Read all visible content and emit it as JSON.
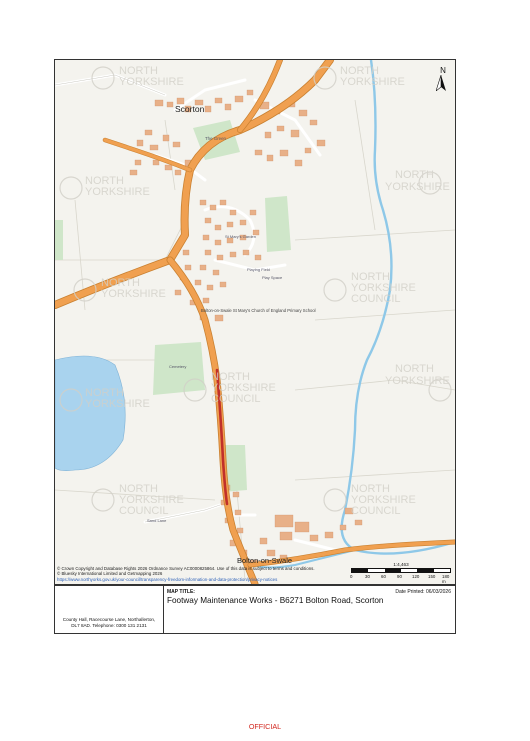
{
  "map": {
    "place_labels": {
      "scorton": "Scorton",
      "bolton": "Bolton-on-Swale",
      "green": "The Green",
      "school": "Bolton-on-Swale St Mary's Church of England Primary School",
      "cemetery": "Cemetery",
      "playing_field": "Playing Field",
      "play_space": "Play Space",
      "garden": "St Mary's Garden",
      "lane": "Sand Lane"
    },
    "watermark": [
      "NORTH",
      "YORKSHIRE",
      "COUNCIL"
    ],
    "north_label": "N",
    "copyright_lines": [
      "© Crown Copyright and Database Rights 2026 Ordnance Survey AC0000825864. Use of this data is subject to terms and conditions.",
      "© Bluesky International Limited and Getmapping 2026"
    ],
    "copyright_link": "https://www.northyorks.gov.uk/your-council/transparency-freedom-information-and-data-protection/privacy-notices",
    "scale_ratio": "1:4,463",
    "scale_ticks": [
      "0",
      "30",
      "60",
      "90",
      "120",
      "150",
      "180 m"
    ],
    "colors": {
      "background": "#f4f3ee",
      "main_road": "#f0a050",
      "minor_road": "#ffffff",
      "building": "#e8b088",
      "green": "#cfe6c9",
      "water": "#a9d3ee",
      "river": "#8ec8e8",
      "highlight": "#c0302a"
    }
  },
  "title_block": {
    "address_lines": [
      "County Hall, Racecourse Lane, Northallerton,",
      "DL7 8AD.  Telephone: 0300 131 2131"
    ],
    "map_title_label": "MAP TITLE:",
    "map_title": "Footway Maintenance Works  -  B6271 Bolton Road, Scorton",
    "date_printed": "Date Printed: 06/03/2026"
  },
  "classification": "OFFICIAL"
}
